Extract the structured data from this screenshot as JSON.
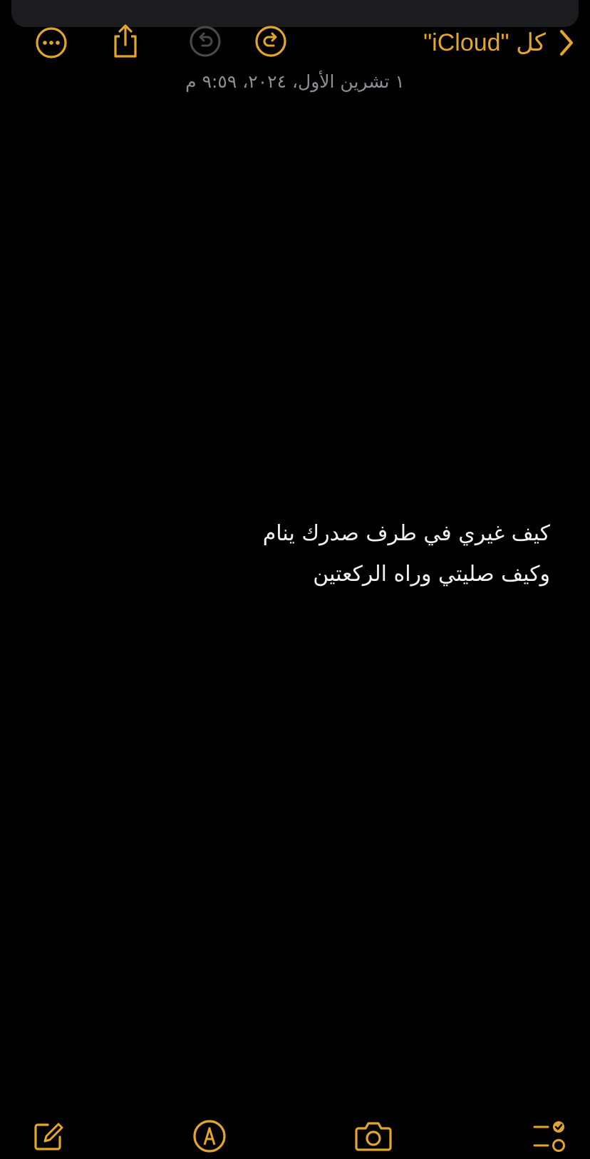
{
  "colors": {
    "accent": "#e3a52a",
    "background": "#000000",
    "text": "#f2f2f2",
    "secondary_text": "#8e8e93",
    "disabled_icon": "#48484a"
  },
  "nav": {
    "back_label": "كل \"iCloud\"",
    "back_icon": "chevron-left-icon",
    "redo_icon": "redo-icon",
    "undo_icon": "undo-icon",
    "undo_enabled": false,
    "share_icon": "share-icon",
    "more_icon": "ellipsis-circle-icon"
  },
  "note": {
    "date": "١ تشرين الأول، ٢٠٢٤، ٩:٥٩ م",
    "lines": [
      "كيف غيري في طرف صدرك ينام",
      "وكيف صليتي وراه الركعتين"
    ]
  },
  "toolbar": {
    "checklist_icon": "checklist-icon",
    "camera_icon": "camera-icon",
    "markup_icon": "markup-pen-icon",
    "compose_icon": "compose-icon"
  }
}
